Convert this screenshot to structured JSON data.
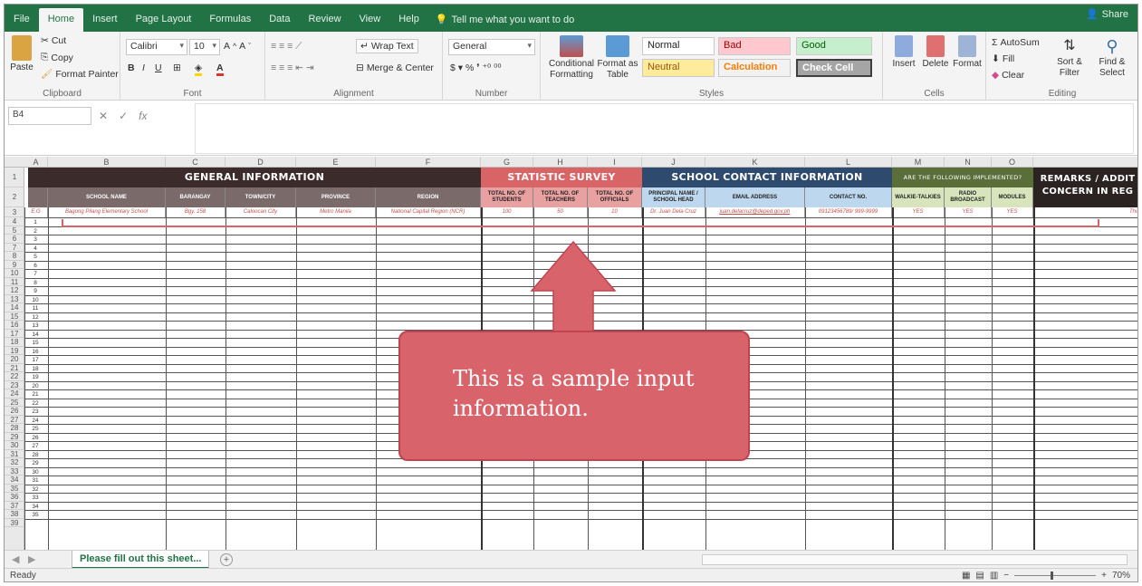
{
  "ribbon_tabs": [
    "File",
    "Home",
    "Insert",
    "Page Layout",
    "Formulas",
    "Data",
    "Review",
    "View",
    "Help"
  ],
  "tell_me": "Tell me what you want to do",
  "share": "Share",
  "clipboard": {
    "paste": "Paste",
    "cut": "Cut",
    "copy": "Copy",
    "format_painter": "Format Painter",
    "label": "Clipboard"
  },
  "font": {
    "name": "Calibri",
    "size": "10",
    "label": "Font"
  },
  "alignment": {
    "wrap": "Wrap Text",
    "merge": "Merge & Center",
    "label": "Alignment"
  },
  "number": {
    "format": "General",
    "label": "Number"
  },
  "styles_group": {
    "conditional": "Conditional Formatting",
    "format_table": "Format as Table",
    "normal": "Normal",
    "bad": "Bad",
    "good": "Good",
    "neutral": "Neutral",
    "calculation": "Calculation",
    "check": "Check Cell",
    "label": "Styles"
  },
  "cells_group": {
    "insert": "Insert",
    "delete": "Delete",
    "format": "Format",
    "label": "Cells"
  },
  "editing": {
    "autosum": "AutoSum",
    "fill": "Fill",
    "clear": "Clear",
    "sort": "Sort & Filter",
    "find": "Find & Select",
    "label": "Editing"
  },
  "namebox": "B4",
  "columns": [
    "A",
    "B",
    "C",
    "D",
    "E",
    "F",
    "G",
    "H",
    "I",
    "J",
    "K",
    "L",
    "M",
    "N",
    "O"
  ],
  "rows": [
    "1",
    "2",
    "3",
    "4",
    "5",
    "6",
    "7",
    "8",
    "9",
    "10",
    "11",
    "12",
    "13",
    "14",
    "15",
    "16",
    "17",
    "18",
    "19",
    "20",
    "21",
    "22",
    "23",
    "24",
    "25",
    "26",
    "27",
    "28",
    "29",
    "30",
    "31",
    "32",
    "33",
    "34",
    "35",
    "36",
    "37",
    "38",
    "39"
  ],
  "sheet": {
    "general_info": "GENERAL INFORMATION",
    "statistic": "STATISTIC SURVEY",
    "contact": "SCHOOL CONTACT INFORMATION",
    "implemented": "ARE THE FOLLOWING IMPLEMENTED?",
    "remarks": "REMARKS / ADDIT CONCERN IN REG",
    "subheaders": [
      "SCHOOL NAME",
      "BARANGAY",
      "TOWN/CITY",
      "PROVINCE",
      "REGION",
      "TOTAL NO. OF STUDENTS",
      "TOTAL NO. OF TEACHERS",
      "TOTAL NO. OF OFFICIALS",
      "PRINCIPAL NAME / SCHOOL HEAD",
      "EMAIL ADDRESS",
      "CONTACT NO.",
      "WALKIE-TALKIES",
      "RADIO BROADCAST",
      "MODULES"
    ],
    "sample_row": [
      "E.G",
      "Bagong Pilang Elementary School",
      "Bgy. 158",
      "Caloocan City",
      "Metro Manila",
      "National Capital Region (NCR)",
      "100",
      "50",
      "10",
      "Dr. Juan Dela Cruz",
      "juan.delacruz@deped.gov.ph",
      "09123456789/ 999-9999",
      "YES",
      "YES",
      "YES",
      "This sc"
    ],
    "row_numbers": [
      "1",
      "2",
      "3",
      "4",
      "5",
      "6",
      "7",
      "8",
      "9",
      "10",
      "11",
      "12",
      "13",
      "14",
      "15",
      "16",
      "17",
      "18",
      "19",
      "20",
      "21",
      "22",
      "23",
      "24",
      "25",
      "26",
      "27",
      "28",
      "29",
      "30",
      "31",
      "32",
      "33",
      "34",
      "35"
    ]
  },
  "callout_text": "This is a sample input information.",
  "sheet_tab": "Please fill out this sheet...",
  "add_sheet": "+",
  "status": "Ready",
  "zoom_pct": "70%"
}
